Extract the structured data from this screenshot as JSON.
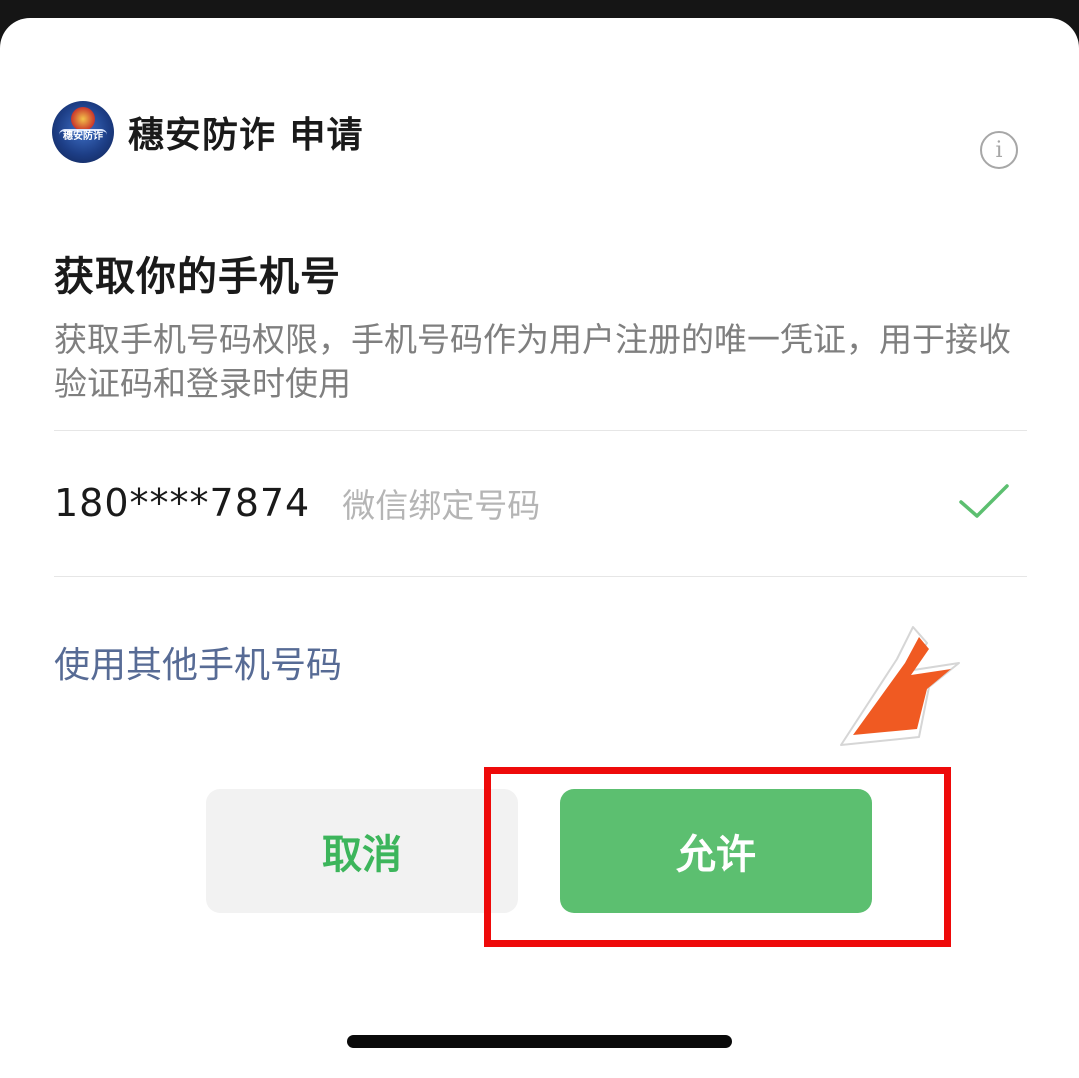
{
  "app": {
    "name": "穗安防诈 申请",
    "logo_text": "穗安防诈"
  },
  "info_icon_glyph": "i",
  "permission": {
    "title": "获取你的手机号",
    "description": "获取手机号码权限，手机号码作为用户注册的唯一凭证，用于接收验证码和登录时使用"
  },
  "phone": {
    "number": "180****7874",
    "tag": "微信绑定号码",
    "selected": true
  },
  "other_phone_label": "使用其他手机号码",
  "buttons": {
    "cancel": "取消",
    "allow": "允许"
  },
  "colors": {
    "accent_green": "#5cbf70",
    "cancel_text": "#3cb55b",
    "link_blue": "#576b95",
    "highlight_red": "#ee0a0a",
    "arrow_orange": "#f05a22"
  }
}
